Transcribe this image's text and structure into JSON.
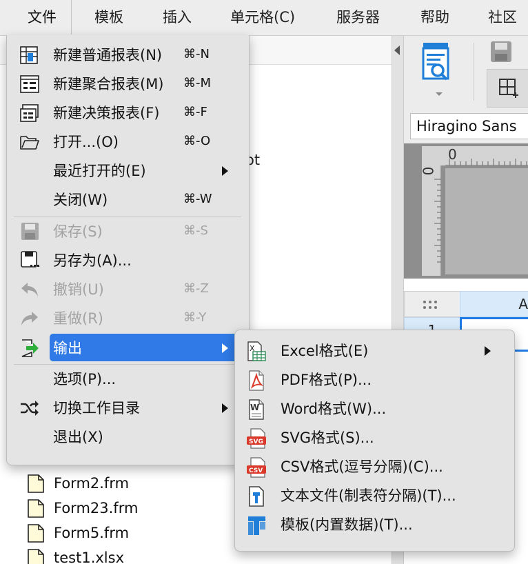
{
  "menubar": {
    "items": [
      {
        "label": "文件",
        "active": true
      },
      {
        "label": "模板"
      },
      {
        "label": "插入"
      },
      {
        "label": "单元格(C)"
      },
      {
        "label": "服务器"
      },
      {
        "label": "帮助"
      },
      {
        "label": "社区"
      }
    ]
  },
  "background": {
    "truncated_text": "ot",
    "font_name": "Hiragino Sans",
    "ruler_h_zero": "0",
    "ruler_v_zero": "0",
    "sheet_col_a": "A",
    "sheet_row_1": "1",
    "files": [
      {
        "name": "Form2.frm"
      },
      {
        "name": "Form23.frm"
      },
      {
        "name": "Form5.frm"
      },
      {
        "name": "test1.xlsx"
      }
    ]
  },
  "file_menu": {
    "items": [
      {
        "label": "新建普通报表(N)",
        "shortcut": "⌘-N",
        "icon": "new-normal-report-icon"
      },
      {
        "label": "新建聚合报表(M)",
        "shortcut": "⌘-M",
        "icon": "new-aggregate-report-icon"
      },
      {
        "label": "新建决策报表(F)",
        "shortcut": "⌘-F",
        "icon": "new-decision-report-icon"
      },
      {
        "label": "打开...(O)",
        "shortcut": "⌘-O",
        "icon": "folder-open-icon"
      },
      {
        "label": "最近打开的(E)",
        "submenu": true
      },
      {
        "label": "关闭(W)",
        "shortcut": "⌘-W"
      },
      {
        "label": "保存(S)",
        "shortcut": "⌘-S",
        "icon": "save-icon",
        "disabled": true
      },
      {
        "label": "另存为(A)...",
        "icon": "save-as-icon"
      },
      {
        "label": "撤销(U)",
        "shortcut": "⌘-Z",
        "icon": "undo-icon",
        "disabled": true
      },
      {
        "label": "重做(R)",
        "shortcut": "⌘-Y",
        "icon": "redo-icon",
        "disabled": true
      },
      {
        "label": "输出",
        "submenu": true,
        "icon": "export-icon",
        "highlighted": true
      },
      {
        "label": "选项(P)..."
      },
      {
        "label": "切换工作目录",
        "submenu": true,
        "icon": "shuffle-icon"
      },
      {
        "label": "退出(X)"
      }
    ]
  },
  "export_submenu": {
    "items": [
      {
        "label": "Excel格式(E)",
        "submenu": true,
        "icon": "excel-icon"
      },
      {
        "label": "PDF格式(P)...",
        "icon": "pdf-icon"
      },
      {
        "label": "Word格式(W)...",
        "icon": "word-icon"
      },
      {
        "label": "SVG格式(S)...",
        "icon": "svg-icon"
      },
      {
        "label": "CSV格式(逗号分隔)(C)...",
        "icon": "csv-icon"
      },
      {
        "label": "文本文件(制表符分隔)(T)...",
        "icon": "text-file-icon"
      },
      {
        "label": "模板(内置数据)(T)...",
        "icon": "template-icon"
      }
    ]
  },
  "colors": {
    "highlight": "#2f7ae6",
    "menu_bg": "#e4e4e4",
    "pdf_red": "#d93a2b",
    "excel_green": "#2e8b57",
    "brand_blue": "#1f7fd8"
  }
}
